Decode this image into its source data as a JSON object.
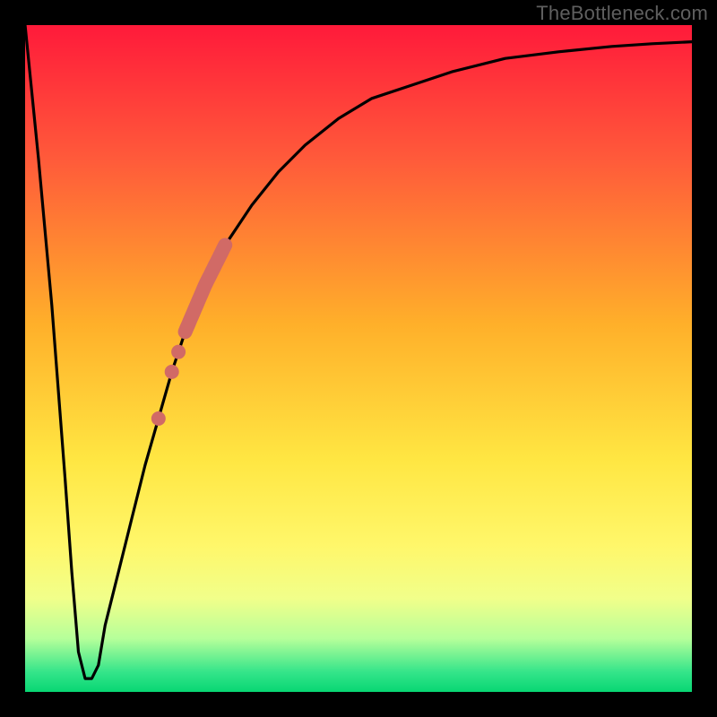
{
  "watermark": "TheBottleneck.com",
  "colors": {
    "frame": "#000000",
    "curve": "#000000",
    "marker": "#d16a66",
    "gradient_stops": [
      {
        "offset": 0.0,
        "color": "#ff1a3a"
      },
      {
        "offset": 0.2,
        "color": "#ff5a3a"
      },
      {
        "offset": 0.45,
        "color": "#ffb02a"
      },
      {
        "offset": 0.65,
        "color": "#ffe642"
      },
      {
        "offset": 0.78,
        "color": "#fff76a"
      },
      {
        "offset": 0.86,
        "color": "#f1ff8a"
      },
      {
        "offset": 0.92,
        "color": "#b6ff9a"
      },
      {
        "offset": 0.97,
        "color": "#35e58a"
      },
      {
        "offset": 1.0,
        "color": "#08d673"
      }
    ]
  },
  "chart_data": {
    "type": "line",
    "title": "",
    "xlabel": "",
    "ylabel": "",
    "xlim": [
      0,
      100
    ],
    "ylim": [
      0,
      100
    ],
    "grid": false,
    "legend": false,
    "annotations": [
      "TheBottleneck.com"
    ],
    "series": [
      {
        "name": "bottleneck-curve",
        "x": [
          0,
          2,
          4,
          6,
          7,
          8,
          9,
          10,
          11,
          12,
          14,
          16,
          18,
          20,
          22,
          24,
          27,
          30,
          34,
          38,
          42,
          47,
          52,
          58,
          64,
          72,
          80,
          88,
          94,
          100
        ],
        "values": [
          100,
          80,
          58,
          32,
          18,
          6,
          2,
          2,
          4,
          10,
          18,
          26,
          34,
          41,
          48,
          54,
          61,
          67,
          73,
          78,
          82,
          86,
          89,
          91,
          93,
          95,
          96,
          96.8,
          97.2,
          97.5
        ]
      }
    ],
    "markers": {
      "name": "range-highlight",
      "type": "thick-segment-with-dots",
      "on_series": "bottleneck-curve",
      "segment": {
        "x_start": 24,
        "x_end": 30
      },
      "dots_x": [
        20,
        22,
        23
      ]
    }
  }
}
